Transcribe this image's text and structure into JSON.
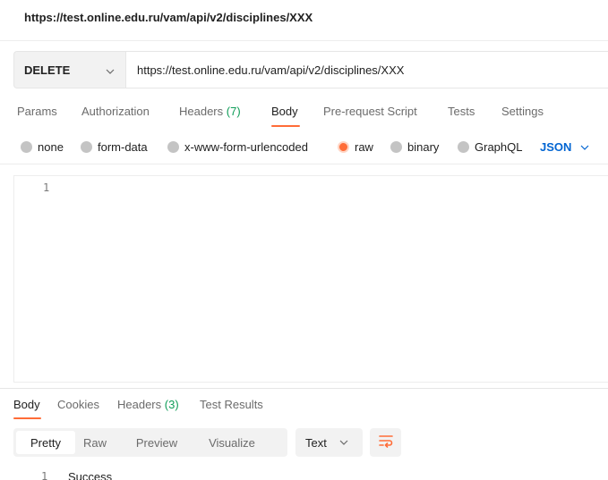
{
  "request": {
    "title": "https://test.online.edu.ru/vam/api/v2/disciplines/XXX",
    "method": "DELETE",
    "url": "https://test.online.edu.ru/vam/api/v2/disciplines/XXX"
  },
  "request_tabs": [
    {
      "label": "Params"
    },
    {
      "label": "Authorization"
    },
    {
      "label": "Headers",
      "count": "(7)"
    },
    {
      "label": "Body"
    },
    {
      "label": "Pre-request Script"
    },
    {
      "label": "Tests"
    },
    {
      "label": "Settings"
    }
  ],
  "body_types": [
    {
      "label": "none"
    },
    {
      "label": "form-data"
    },
    {
      "label": "x-www-form-urlencoded"
    },
    {
      "label": "raw"
    },
    {
      "label": "binary"
    },
    {
      "label": "GraphQL"
    }
  ],
  "body_format": "JSON",
  "editor": {
    "line_number": "1"
  },
  "response_tabs": [
    {
      "label": "Body"
    },
    {
      "label": "Cookies"
    },
    {
      "label": "Headers",
      "count": "(3)"
    },
    {
      "label": "Test Results"
    }
  ],
  "view_modes": [
    {
      "label": "Pretty"
    },
    {
      "label": "Raw"
    },
    {
      "label": "Preview"
    },
    {
      "label": "Visualize"
    }
  ],
  "response_format": "Text",
  "response": {
    "line_number": "1",
    "text": "Success"
  },
  "colors": {
    "accent": "#ff6c37",
    "count": "#0f9d58",
    "link": "#0265d2"
  },
  "icons": {
    "method_chevron": "chevron-down-icon",
    "json_chevron": "chevron-down-icon",
    "format_chevron": "chevron-down-icon",
    "wrap": "wrap-lines-icon"
  }
}
